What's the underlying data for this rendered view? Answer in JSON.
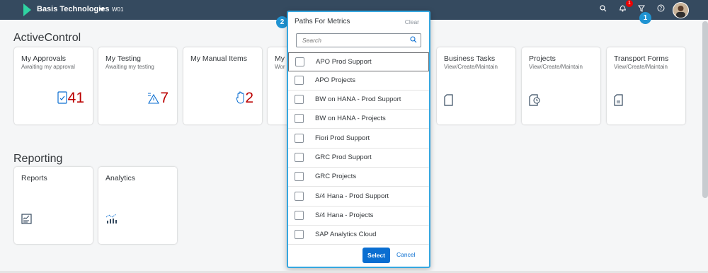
{
  "shell": {
    "company": "Basis Technologies",
    "system": "W01",
    "notification_count": "1",
    "icons": [
      "search-icon",
      "bell-icon",
      "filter-icon",
      "help-icon"
    ]
  },
  "steps": {
    "one": "1",
    "two": "2"
  },
  "sections": {
    "active_control": "ActiveControl",
    "reporting": "Reporting"
  },
  "tiles": [
    {
      "title": "My Approvals",
      "subtitle": "Awaiting my approval",
      "number": "41",
      "icon": "approval-document-icon"
    },
    {
      "title": "My Testing",
      "subtitle": "Awaiting my testing",
      "number": "7",
      "icon": "warning-list-icon"
    },
    {
      "title": "My Manual Items",
      "subtitle": "",
      "number": "2",
      "icon": "hand-icon"
    },
    {
      "title": "My",
      "subtitle": "Wor",
      "number": "",
      "icon": ""
    },
    {
      "title": "Business Tasks",
      "subtitle": "View/Create/Maintain",
      "number": "",
      "icon": "document-icon"
    },
    {
      "title": "Projects",
      "subtitle": "View/Create/Maintain",
      "number": "",
      "icon": "project-clock-icon"
    },
    {
      "title": "Transport Forms",
      "subtitle": "View/Create/Maintain",
      "number": "",
      "icon": "form-icon"
    }
  ],
  "reporting_tiles": [
    {
      "title": "Reports",
      "icon": "report-icon"
    },
    {
      "title": "Analytics",
      "icon": "analytics-icon"
    }
  ],
  "popover": {
    "title": "Paths For Metrics",
    "clear": "Clear",
    "search_placeholder": "Search",
    "items": [
      "APO Prod Support",
      "APO Projects",
      "BW on HANA - Prod Support",
      "BW on HANA - Projects",
      "Fiori Prod Support",
      "GRC Prod Support",
      "GRC Projects",
      "S/4 Hana - Prod Support",
      "S/4 Hana - Projects",
      "SAP Analytics Cloud"
    ],
    "select": "Select",
    "cancel": "Cancel"
  },
  "colors": {
    "shell": "#354a5f",
    "accent": "#0a6ed1",
    "number": "#bb0000",
    "focus": "#35a7e0"
  }
}
